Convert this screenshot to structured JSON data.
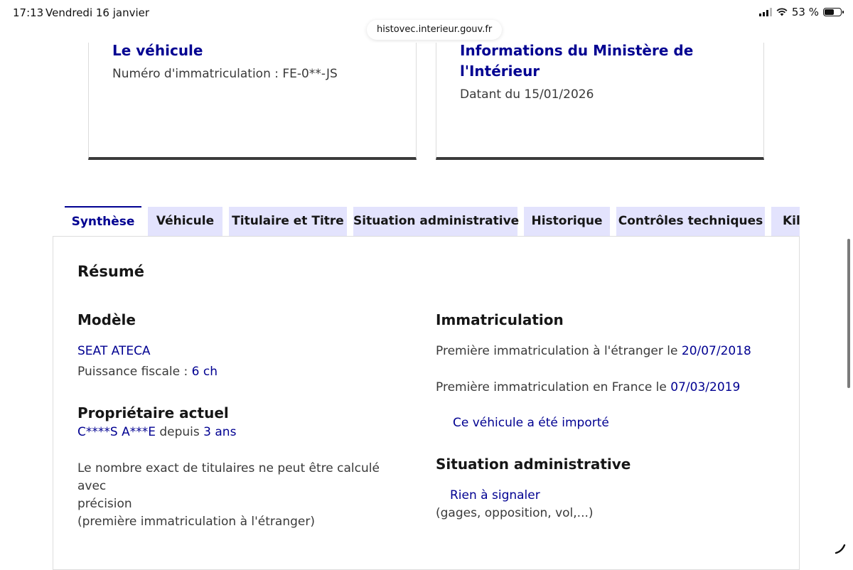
{
  "status_bar": {
    "time": "17:13",
    "date": "Vendredi 16 janvier",
    "battery": "53 %",
    "battery_level": 0.53
  },
  "browser": {
    "url": "histovec.interieur.gouv.fr"
  },
  "cards": {
    "vehicle": {
      "title": "Le véhicule",
      "subtitle": "Numéro d'immatriculation : FE-0**-JS"
    },
    "ministry": {
      "title": "Informations du Ministère de l'Intérieur",
      "subtitle": "Datant du 15/01/2026"
    }
  },
  "tabs": [
    {
      "label": "Synthèse",
      "active": true
    },
    {
      "label": "Véhicule",
      "active": false
    },
    {
      "label": "Titulaire et Titre",
      "active": false
    },
    {
      "label": "Situation administrative",
      "active": false
    },
    {
      "label": "Historique",
      "active": false
    },
    {
      "label": "Contrôles techniques",
      "active": false
    },
    {
      "label": "Kil",
      "active": false
    }
  ],
  "summary": {
    "title": "Résumé",
    "model": {
      "heading": "Modèle",
      "name": "SEAT ATECA",
      "power_label": "Puissance fiscale :",
      "power_value": "6 ch"
    },
    "owner": {
      "heading": "Propriétaire actuel",
      "name": "C****S A***E",
      "since_label": "depuis",
      "since_value": "3 ans",
      "note_line1": "Le nombre exact de titulaires ne peut être calculé avec",
      "note_line2": "précision",
      "note_line3": "(première immatriculation à l'étranger)"
    },
    "registration": {
      "heading": "Immatriculation",
      "foreign_label": "Première immatriculation à l'étranger le",
      "foreign_date": "20/07/2018",
      "france_label": "Première immatriculation en France le",
      "france_date": "07/03/2019",
      "imported": "Ce véhicule a été importé"
    },
    "admin": {
      "heading": "Situation administrative",
      "status": "Rien à signaler",
      "detail": "(gages, opposition, vol,...)"
    }
  },
  "colors": {
    "accent": "#000091",
    "tab_bg": "#e3e3fd",
    "text": "#3a3a3a"
  }
}
